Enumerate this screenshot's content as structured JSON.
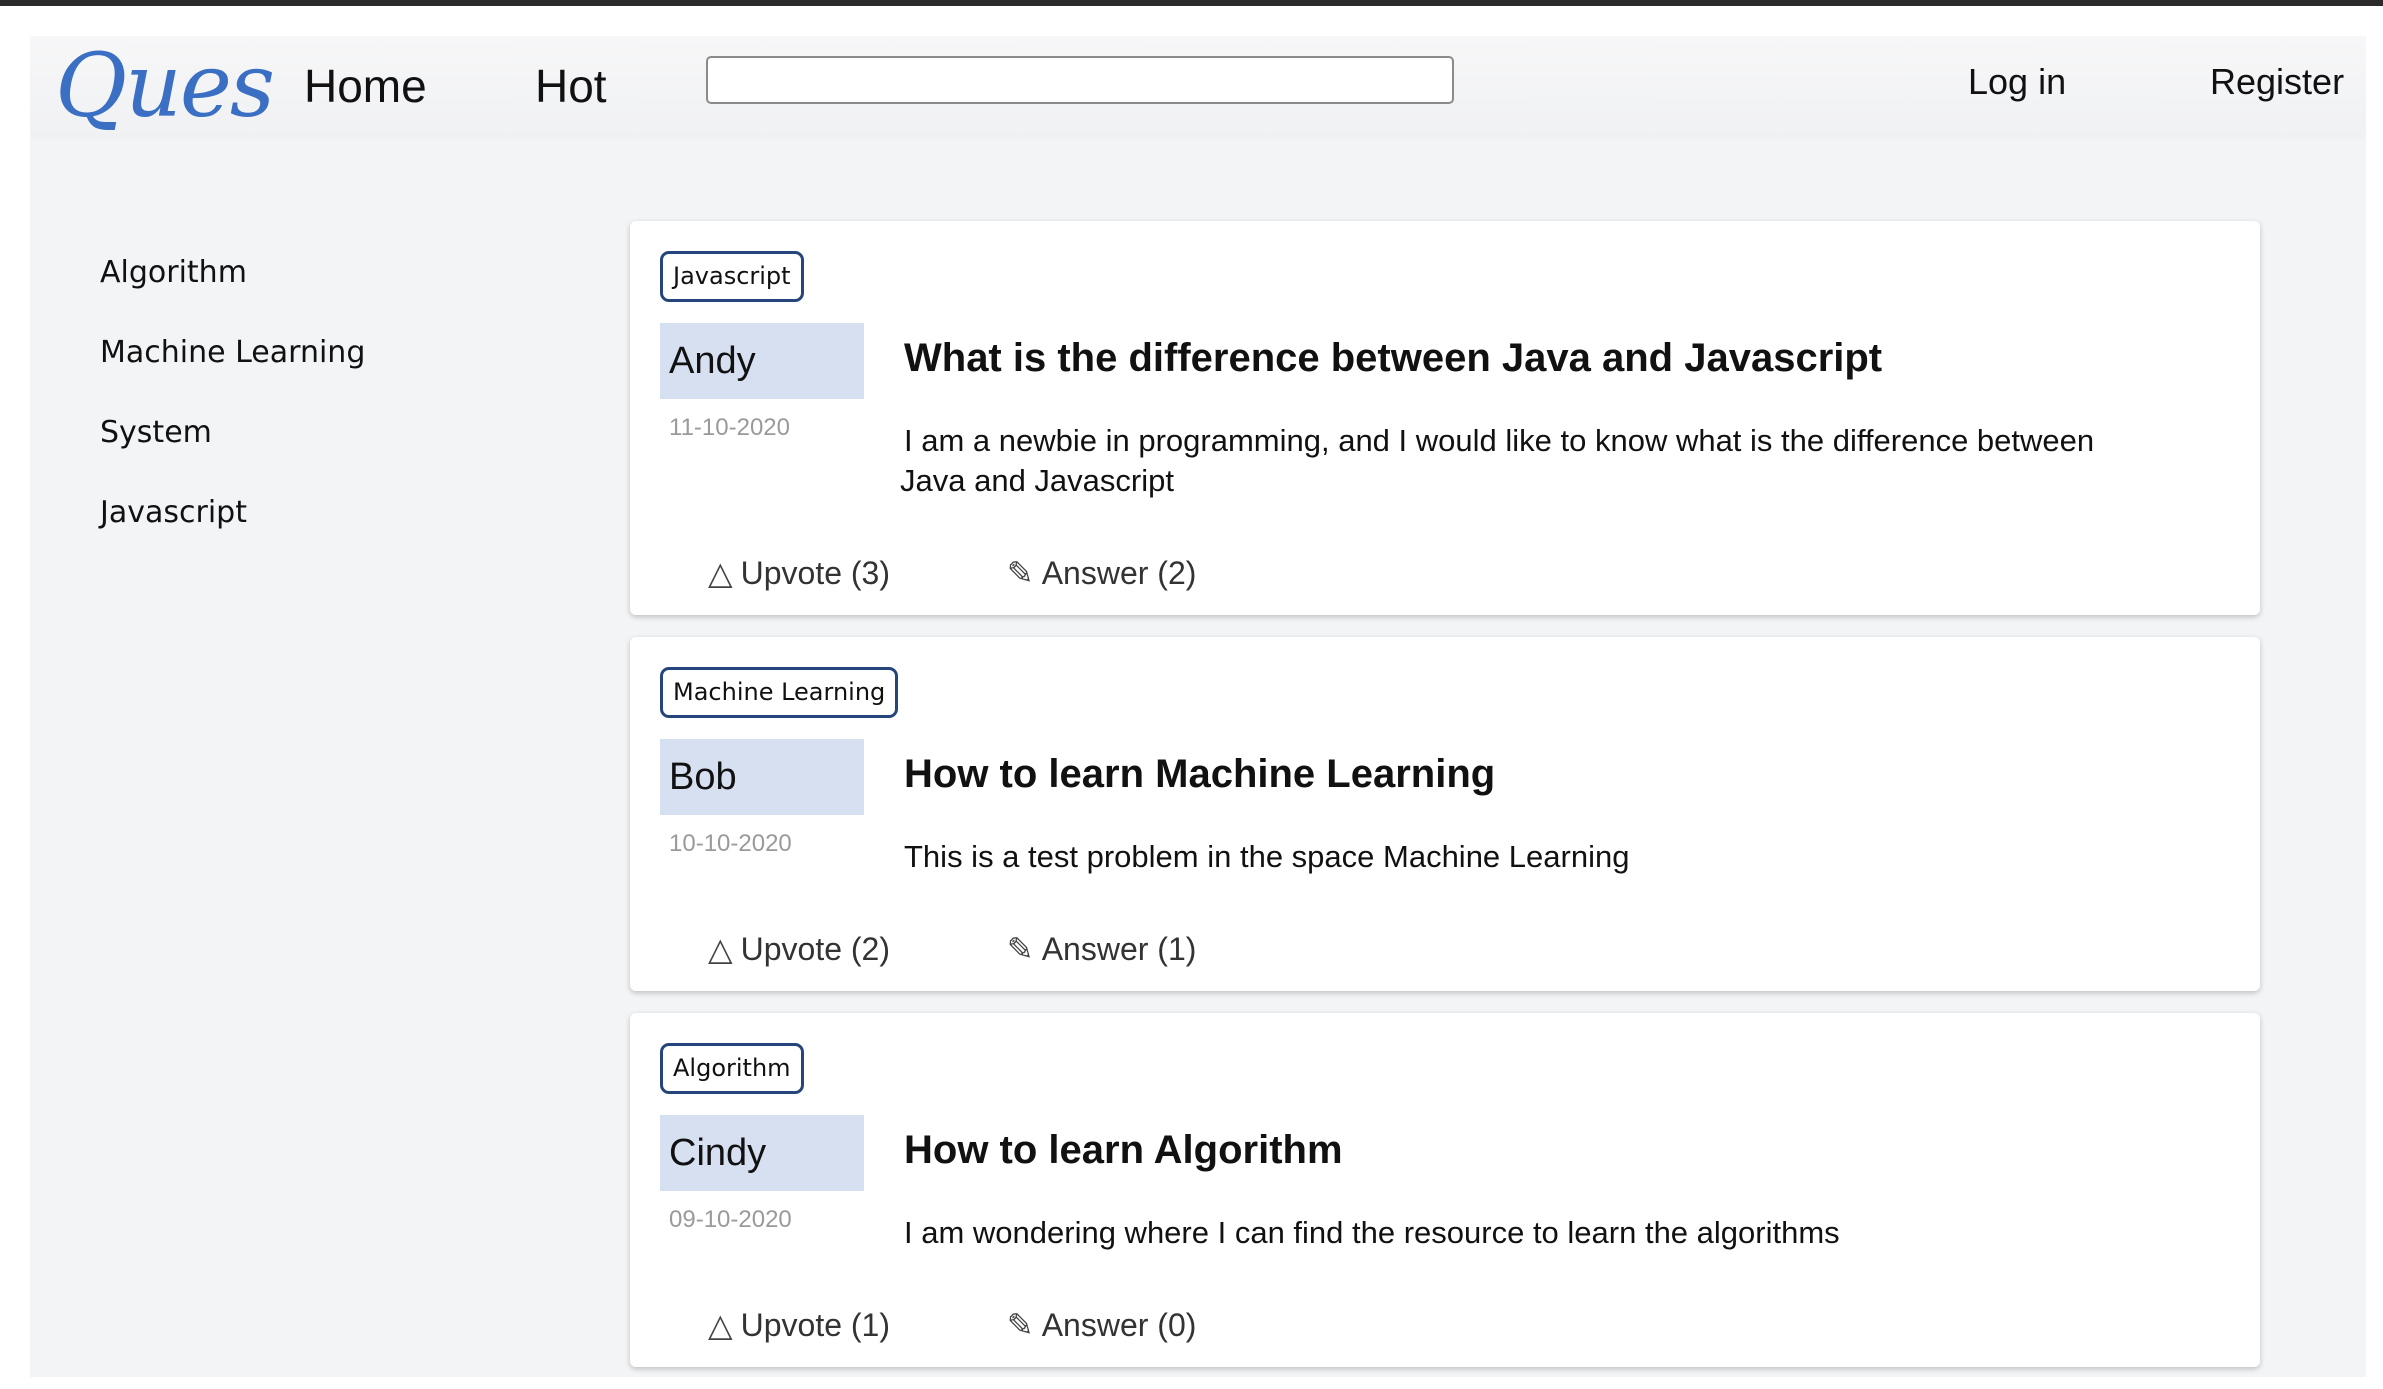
{
  "header": {
    "logo": "Ques",
    "nav": {
      "home": "Home",
      "hot": "Hot"
    },
    "search": {
      "value": "",
      "placeholder": ""
    },
    "auth": {
      "login": "Log in",
      "register": "Register"
    }
  },
  "sidebar": {
    "items": [
      {
        "label": "Algorithm"
      },
      {
        "label": "Machine Learning"
      },
      {
        "label": "System"
      },
      {
        "label": "Javascript"
      }
    ]
  },
  "icons": {
    "upvote": "triangle-up-icon",
    "answer": "pencil-icon"
  },
  "questions": [
    {
      "tag": "Javascript",
      "author": "Andy",
      "date": "11-10-2020",
      "title": "What is the difference between Java and Javascript",
      "body_line1": "I am a newbie in programming, and I would like to know what is the difference between",
      "body_line2": "Java and Javascript",
      "upvote": "Upvote (3)",
      "answer": "Answer (2)"
    },
    {
      "tag": "Machine Learning",
      "author": "Bob",
      "date": "10-10-2020",
      "title": "How to learn Machine Learning",
      "body_line1": "This is a test problem in the space Machine Learning",
      "body_line2": "",
      "upvote": "Upvote (2)",
      "answer": "Answer (1)"
    },
    {
      "tag": "Algorithm",
      "author": "Cindy",
      "date": "09-10-2020",
      "title": "How to learn Algorithm",
      "body_line1": "I am wondering where I can find the resource to learn the algorithms",
      "body_line2": "",
      "upvote": "Upvote (1)",
      "answer": "Answer (0)"
    }
  ],
  "colors": {
    "logo": "#3a6fc4",
    "tag_border": "#26457a",
    "author_bg": "#d7e0f0",
    "page_bg": "#f3f4f6"
  }
}
